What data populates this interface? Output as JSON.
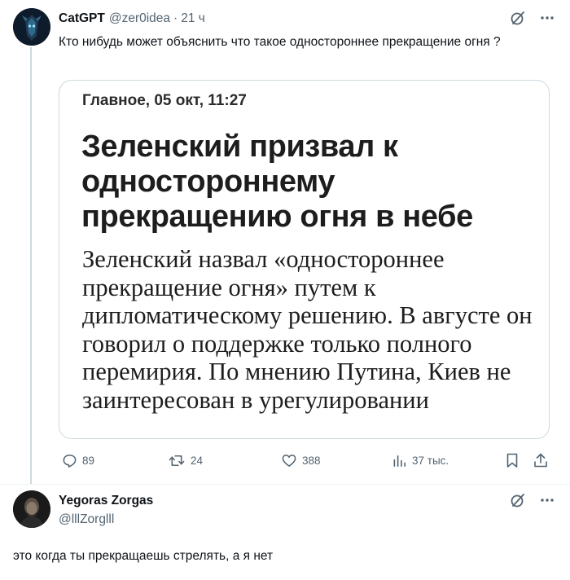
{
  "tweet1": {
    "author_name": "CatGPT",
    "handle": "@zer0idea",
    "separator": "·",
    "time": "21 ч",
    "text": "Кто нибудь может объяснить что такое одностороннее прекращение огня ?",
    "card": {
      "meta": "Главное, 05 окт, 11:27",
      "title": "Зеленский призвал к одностороннему прекращению огня в небе",
      "body": "Зеленский назвал «одностороннее прекращение огня» путем к дипломатическому решению. В августе он говорил о поддержке только полного перемирия. По мнению Путина, Киев не заинтересован в урегулировании"
    },
    "actions": {
      "replies": "89",
      "retweets": "24",
      "likes": "388",
      "views": "37 тыс."
    }
  },
  "tweet2": {
    "author_name": "Yegoras Zorgas",
    "handle": "@lllZorglll",
    "text": "это когда ты прекращаешь стрелять, а я нет"
  },
  "icons": {
    "reply": "reply-icon",
    "retweet": "retweet-icon",
    "like": "heart-icon",
    "views": "views-icon",
    "bookmark": "bookmark-icon",
    "share": "share-icon",
    "grok": "grok-icon",
    "more": "more-icon"
  },
  "colors": {
    "secondary_text": "#536471",
    "border": "#cfd9de",
    "text": "#0f1419"
  }
}
